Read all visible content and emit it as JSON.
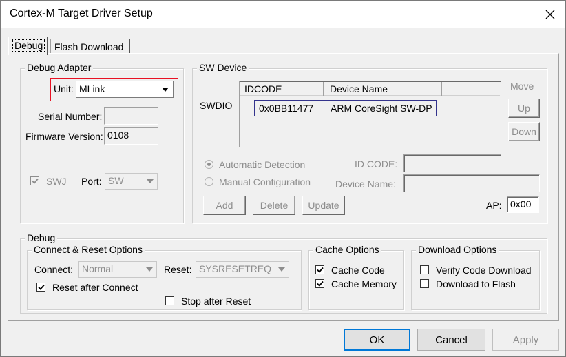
{
  "window": {
    "title": "Cortex-M Target Driver Setup"
  },
  "tabs": [
    {
      "label": "Debug",
      "active": true
    },
    {
      "label": "Flash Download",
      "active": false
    }
  ],
  "debug_adapter": {
    "title": "Debug Adapter",
    "unit_label": "Unit:",
    "unit_value": "MLink",
    "serial_label": "Serial Number:",
    "serial_value": "",
    "firmware_label": "Firmware Version:",
    "firmware_value": "0108",
    "swj_label": "SWJ",
    "swj_checked": true,
    "port_label": "Port:",
    "port_value": "SW",
    "highlight_color": "#e81123"
  },
  "sw_device": {
    "title": "SW Device",
    "swdio_label": "SWDIO",
    "columns": [
      "IDCODE",
      "Device Name"
    ],
    "rows": [
      {
        "idcode": "0x0BB11477",
        "device_name": "ARM CoreSight SW-DP"
      }
    ],
    "move_label": "Move",
    "up_label": "Up",
    "down_label": "Down",
    "auto_detection_label": "Automatic Detection",
    "manual_config_label": "Manual Configuration",
    "id_code_label": "ID CODE:",
    "device_name_label": "Device Name:",
    "add_label": "Add",
    "delete_label": "Delete",
    "update_label": "Update",
    "ap_label": "AP:",
    "ap_value": "0x00",
    "row_border_color": "#33338c"
  },
  "debug": {
    "title": "Debug",
    "connect_reset": {
      "title": "Connect & Reset Options",
      "connect_label": "Connect:",
      "connect_value": "Normal",
      "reset_label": "Reset:",
      "reset_value": "SYSRESETREQ",
      "reset_after_connect_label": "Reset after Connect",
      "reset_after_connect_checked": true,
      "stop_after_reset_label": "Stop after Reset",
      "stop_after_reset_checked": false
    },
    "cache": {
      "title": "Cache Options",
      "cache_code_label": "Cache Code",
      "cache_code_checked": true,
      "cache_memory_label": "Cache Memory",
      "cache_memory_checked": true
    },
    "download": {
      "title": "Download Options",
      "verify_label": "Verify Code Download",
      "verify_checked": false,
      "download_flash_label": "Download to Flash",
      "download_flash_checked": false
    }
  },
  "footer": {
    "ok_label": "OK",
    "cancel_label": "Cancel",
    "apply_label": "Apply"
  },
  "icons": {
    "close": "close-icon",
    "dropdown": "chevron-down-icon",
    "check": "checkmark-icon"
  }
}
